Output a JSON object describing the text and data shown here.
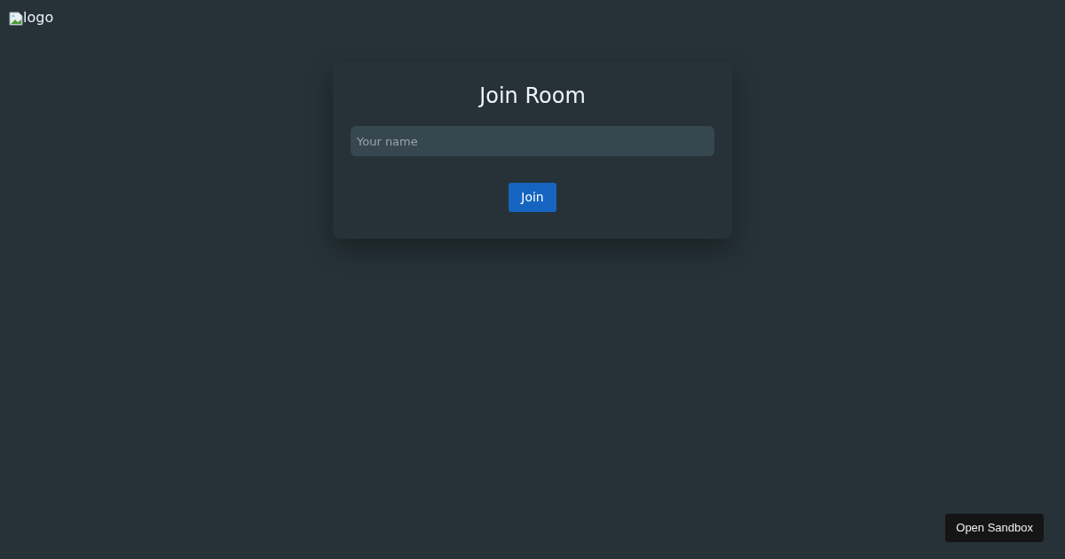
{
  "logo": {
    "alt": "logo"
  },
  "card": {
    "title": "Join Room",
    "name_field": {
      "placeholder": "Your name"
    },
    "button": "Join"
  },
  "sandbox_button": "Open Sandbox"
}
